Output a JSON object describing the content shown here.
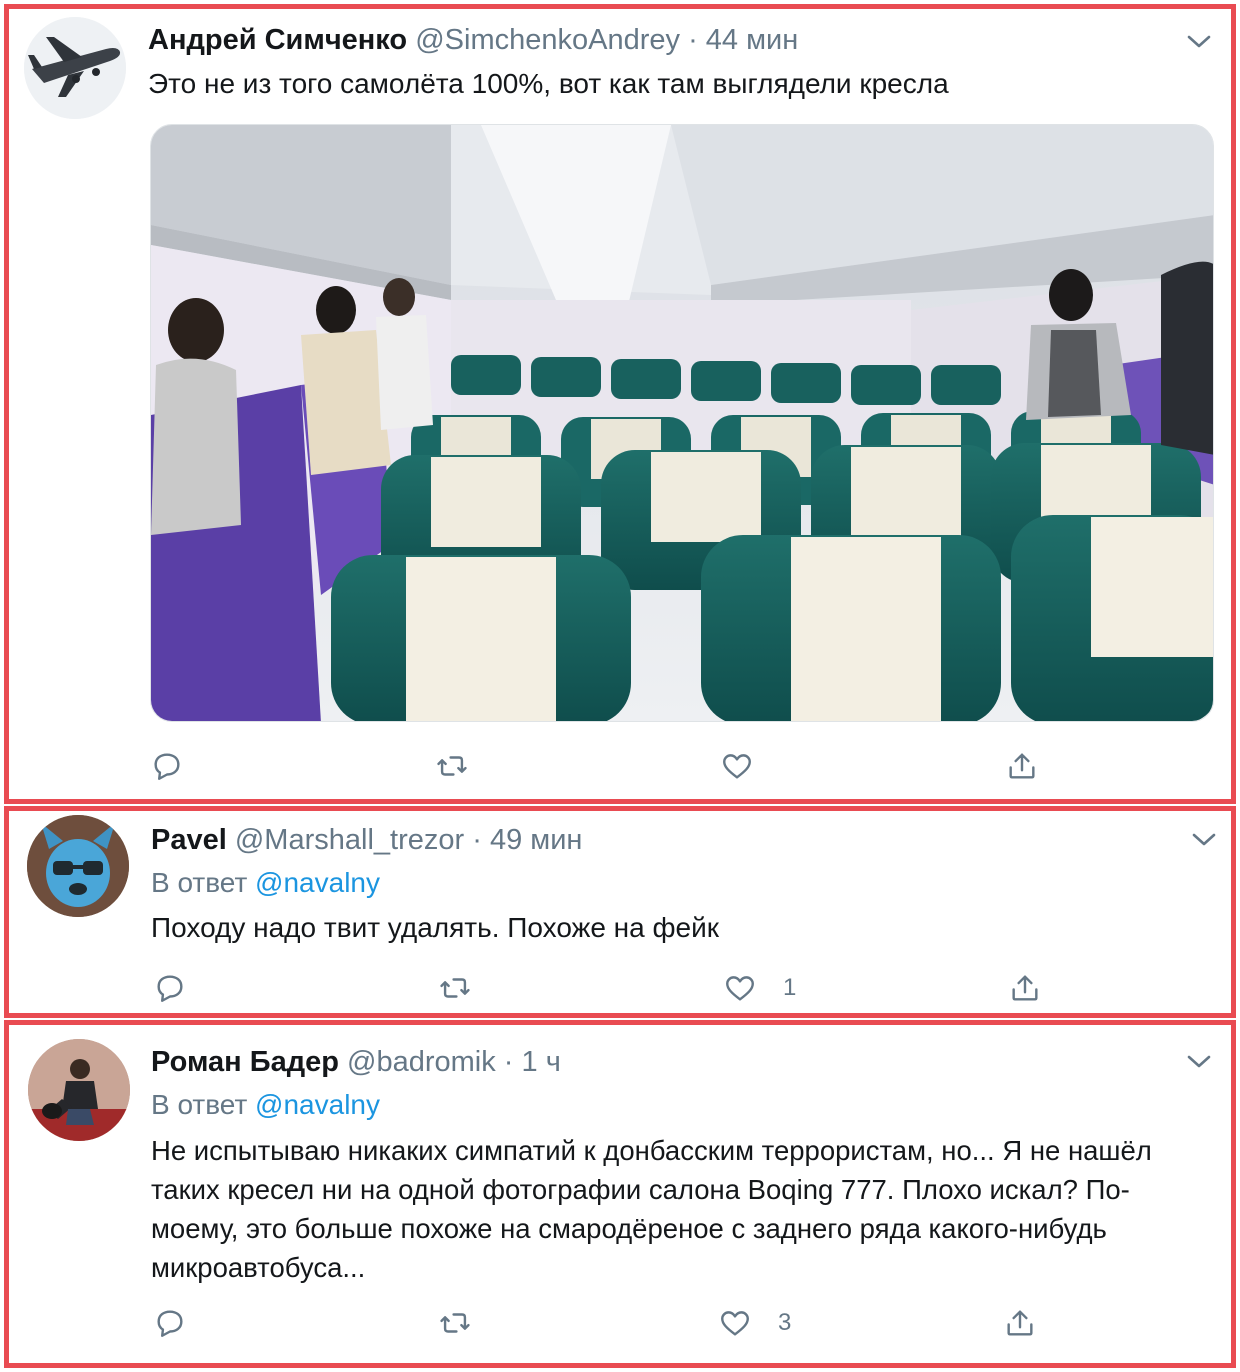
{
  "tweets": [
    {
      "author_name": "Андрей Симченко",
      "handle": "@SimchenkoAndrey",
      "separator": "·",
      "time": "44 мин",
      "text": "Это не из того самолёта 100%, вот как там выглядели кресла",
      "has_media": true,
      "media_subject": "aircraft cabin interior with rows of green economy seats",
      "like_count": ""
    },
    {
      "author_name": "Pavel",
      "handle": "@Marshall_trezor",
      "separator": "·",
      "time": "49 мин",
      "reply_prefix": "В ответ",
      "reply_mention": "@navalny",
      "text": "Походу надо твит удалять. Похоже на фейк",
      "like_count": "1"
    },
    {
      "author_name": "Роман Бадер",
      "handle": "@badromik",
      "separator": "·",
      "time": "1 ч",
      "reply_prefix": "В ответ",
      "reply_mention": "@navalny",
      "text": "Не испытываю никаких симпатий к донбасским террористам, но... Я не нашёл таких кресел ни на одной фотографии салона Boqing 777. Плохо искал? По-моему, это больше похоже на смародёреное с заднего ряда какого-нибудь микроавтобуса...",
      "like_count": "3"
    }
  ],
  "icons": {
    "reply": "comment-bubble-icon",
    "retweet": "retweet-arrows-icon",
    "like": "heart-icon",
    "share": "share-upload-icon",
    "menu": "chevron-down-icon"
  },
  "colors": {
    "frame_border": "#e94b52",
    "mention": "#1b95e0",
    "secondary_text": "#657786",
    "primary_text": "#14171a"
  }
}
